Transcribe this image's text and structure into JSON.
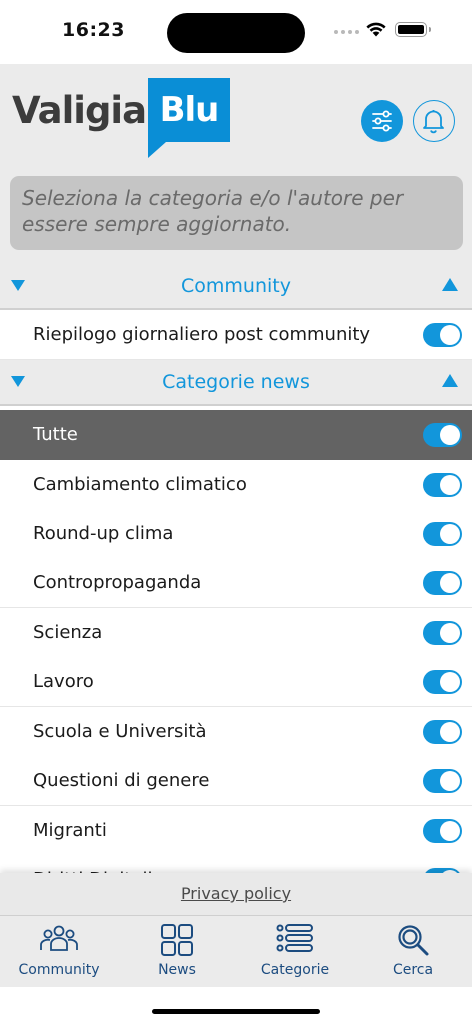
{
  "status": {
    "time": "16:23"
  },
  "header": {
    "logo_text": "Valigia",
    "logo_box_text": "Blu",
    "filter_icon": "sliders-icon",
    "bell_icon": "bell-icon"
  },
  "notice": "Seleziona la categoria e/o l'autore per essere sempre aggiornato.",
  "sections": {
    "community": {
      "title": "Community",
      "items": [
        {
          "label": "Riepilogo giornaliero post community",
          "enabled": true
        }
      ]
    },
    "news": {
      "title": "Categorie news",
      "items": [
        {
          "label": "Tutte",
          "enabled": true,
          "selected": true
        },
        {
          "label": "Cambiamento climatico",
          "enabled": true
        },
        {
          "label": "Round-up clima",
          "enabled": true
        },
        {
          "label": "Contropropaganda",
          "enabled": true
        },
        {
          "label": "Scienza",
          "enabled": true
        },
        {
          "label": "Lavoro",
          "enabled": true
        },
        {
          "label": "Scuola e Università",
          "enabled": true
        },
        {
          "label": "Questioni di genere",
          "enabled": true
        },
        {
          "label": "Migranti",
          "enabled": true
        },
        {
          "label": "Diritti Digitali",
          "enabled": true
        }
      ]
    }
  },
  "privacy_link": "Privacy policy",
  "tabs": [
    {
      "label": "Community",
      "icon": "people-icon"
    },
    {
      "label": "News",
      "icon": "grid-icon"
    },
    {
      "label": "Categorie",
      "icon": "list-icon"
    },
    {
      "label": "Cerca",
      "icon": "search-icon"
    }
  ],
  "colors": {
    "accent": "#1296db",
    "tab_label": "#1c4c80",
    "selected_row": "#636363",
    "header_bg": "#ebebeb"
  }
}
